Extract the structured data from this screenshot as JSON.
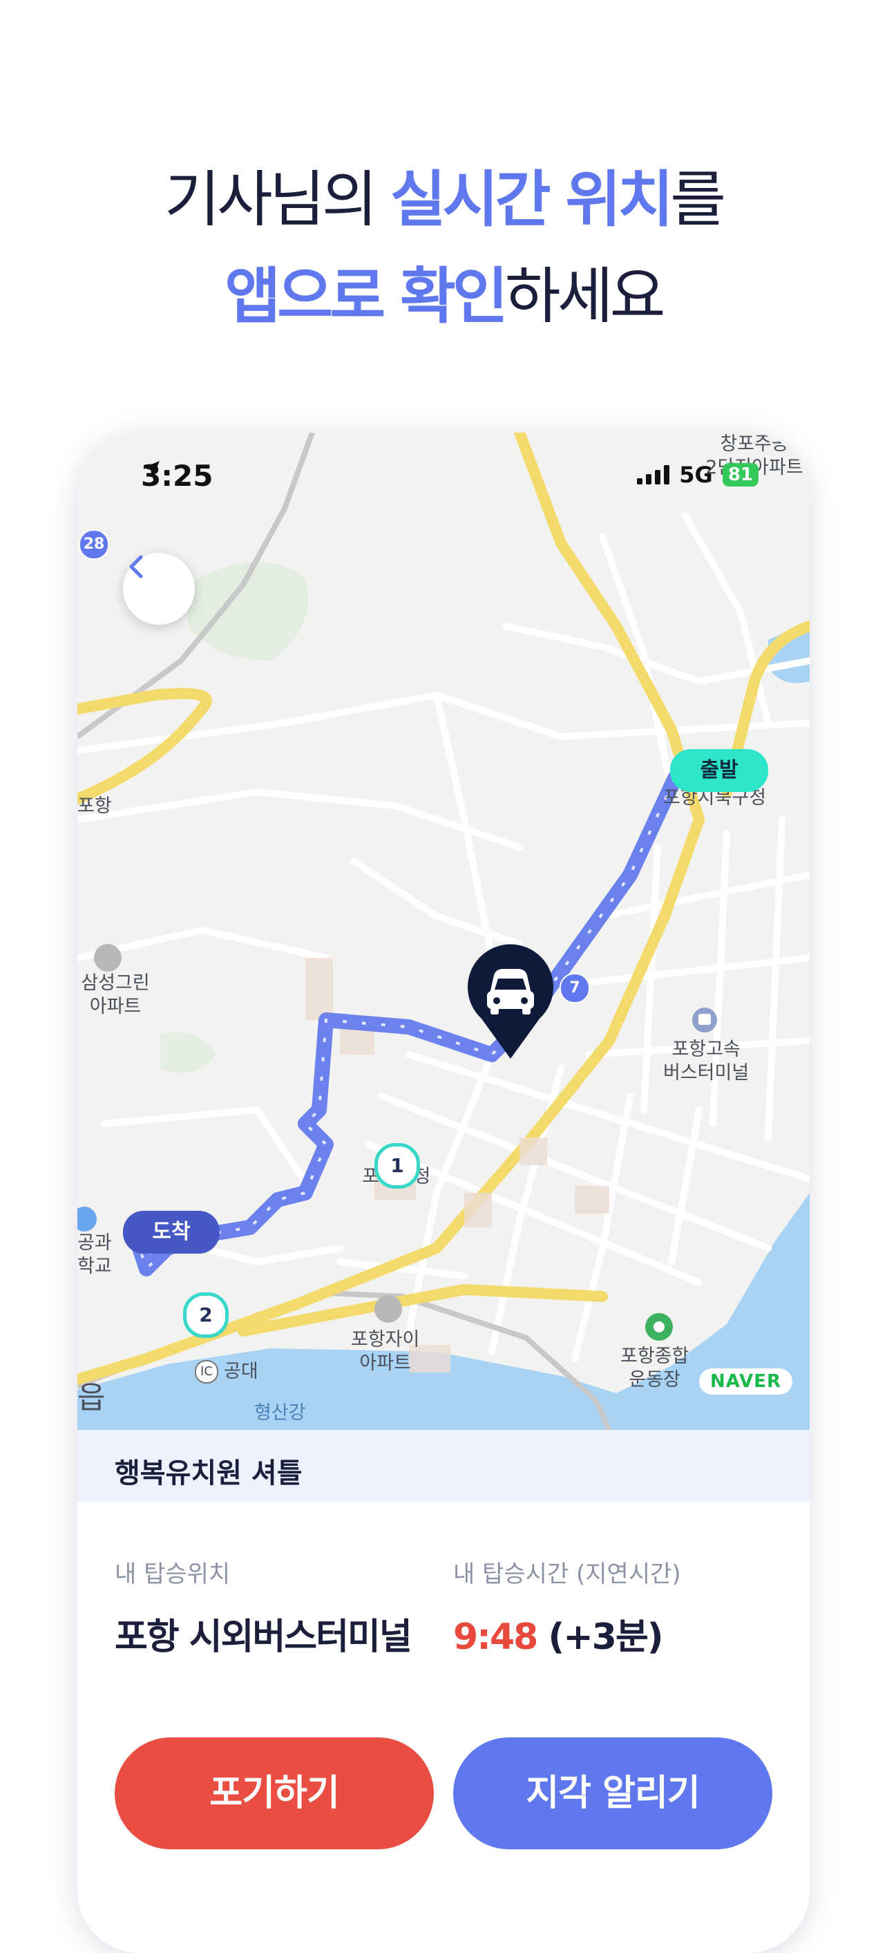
{
  "headline": {
    "line1_pre": "기사님의 ",
    "line1_hl": "실시간 위치",
    "line1_post": "를",
    "line2_hl": "앱으로 확인",
    "line2_post": "하세요"
  },
  "status_bar": {
    "time": "3:25",
    "network": "5G",
    "battery": "81"
  },
  "map": {
    "start_label": "출발",
    "end_label": "도착",
    "stops": [
      "1",
      "2"
    ],
    "road_signs": [
      "28",
      "7"
    ],
    "places": [
      "창포주공\n2단지아파트",
      "포항시북구청",
      "포항",
      "삼성그린\n아파트",
      "포항고속\n버스터미널",
      "포항시청",
      "공과\n학교",
      "포항자이\n아파트",
      "포항종합\n운동장",
      "공대",
      "형산강",
      "읍"
    ],
    "ic_label": "IC",
    "provider": "NAVER"
  },
  "shuttle": {
    "name": "행복유치원 셔틀"
  },
  "boarding": {
    "location_label": "내 탑승위치",
    "location_value": "포항 시외버스터미널",
    "time_label": "내 탑승시간 (지연시간)",
    "time_value": "9:48",
    "delay_value": "(+3분)"
  },
  "actions": {
    "cancel_label": "포기하기",
    "late_label": "지각 알리기"
  },
  "colors": {
    "accent": "#5f78ee",
    "danger": "#e8493d",
    "start_badge": "#2de6c9",
    "end_badge": "#4657c6",
    "route": "#5f78ee"
  }
}
